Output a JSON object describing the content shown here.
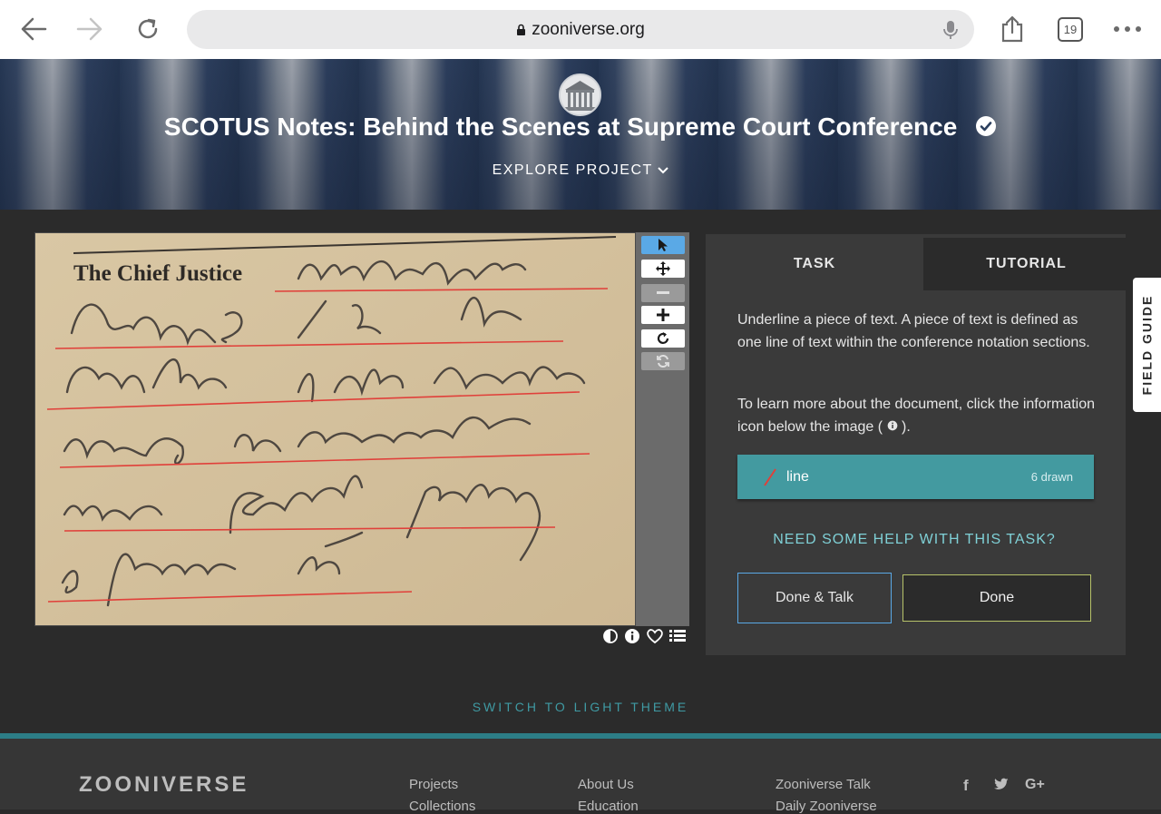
{
  "browser": {
    "url": "zooniverse.org",
    "tab_count": "19",
    "icons": [
      "back-arrow-icon",
      "forward-arrow-icon",
      "reload-icon",
      "lock-icon",
      "microphone-icon",
      "share-icon",
      "tabs-icon",
      "more-icon"
    ]
  },
  "project": {
    "title": "SCOTUS Notes: Behind the Scenes at Supreme Court Conference",
    "explore_label": "EXPLORE PROJECT",
    "verified_icon": "check-circle-icon"
  },
  "subject": {
    "printed_heading": "The Chief Justice",
    "line_color": "#e0403a"
  },
  "panel": {
    "tabs": [
      {
        "label": "TASK"
      },
      {
        "label": "TUTORIAL"
      }
    ],
    "instruction_1": "Underline a piece of text. A piece of text is defined as one line of text within the conference notation sections.",
    "instruction_2a": "To learn more about the document, click the information icon below the image (",
    "instruction_2b": ").",
    "tool": {
      "label": "line",
      "count": "6 drawn",
      "color": "#439aa0"
    },
    "help_label": "NEED SOME HELP WITH THIS TASK?",
    "done_talk_label": "Done & Talk",
    "done_label": "Done"
  },
  "field_guide_label": "FIELD GUIDE",
  "switch_theme_label": "SWITCH TO LIGHT THEME",
  "footer": {
    "logo": "ZOONIVERSE",
    "col1": [
      "Projects",
      "Collections"
    ],
    "col2": [
      "About Us",
      "Education"
    ],
    "col3": [
      "Zooniverse Talk",
      "Daily Zooniverse"
    ],
    "social": [
      "f",
      "twitter-icon",
      "G+"
    ]
  },
  "colors": {
    "teal": "#439aa0",
    "accent_blue": "#5aa9e6",
    "done_border": "#b7c36a",
    "panel_bg": "#3a3a3a"
  }
}
